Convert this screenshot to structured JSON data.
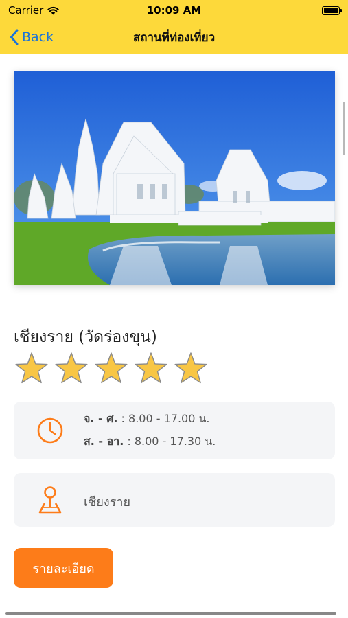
{
  "status_bar": {
    "carrier": "Carrier",
    "time": "10:09 AM",
    "icons": [
      "wifi-icon",
      "battery-icon"
    ]
  },
  "nav": {
    "back_label": "Back",
    "title": "สถานที่ท่องเที่ยว",
    "back_icon": "chevron-left-icon"
  },
  "place": {
    "name": "เชียงราย (วัดร่องขุน)",
    "image": "white-temple-photo",
    "rating": 5,
    "rating_max": 5
  },
  "hours": {
    "icon": "clock-icon",
    "weekday_label": "จ. - ศ.",
    "weekday_time": " : 8.00 - 17.00 น.",
    "weekend_label": "ส. - อา.",
    "weekend_time": " : 8.00 - 17.30 น."
  },
  "location": {
    "icon": "location-pin-icon",
    "text": "เชียงราย"
  },
  "actions": {
    "detail_label": "รายละเอียด"
  },
  "colors": {
    "header_bg": "#fdd93a",
    "accent": "#fd7c19",
    "link": "#1a73d9",
    "star": "#f8c645",
    "card_bg": "#f4f5f7"
  }
}
